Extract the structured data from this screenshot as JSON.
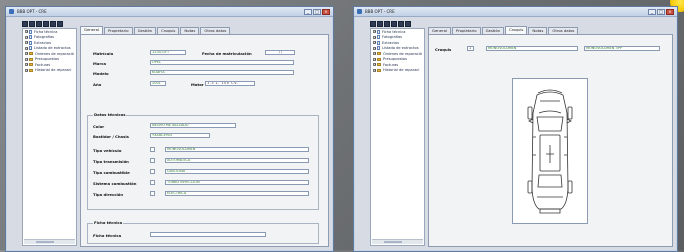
{
  "left_window": {
    "title": "BBB OPT - CRE",
    "tree": [
      {
        "label": "Ficha técnica",
        "type": "doc",
        "expand": "+"
      },
      {
        "label": "Fotografías",
        "type": "doc",
        "expand": "+"
      },
      {
        "label": "Extractos",
        "type": "doc",
        "expand": "+"
      },
      {
        "label": "Listado de extractos",
        "type": "doc",
        "expand": "+"
      },
      {
        "label": "Órdenes de reparació",
        "type": "folder",
        "expand": "+"
      },
      {
        "label": "Presupuestos",
        "type": "folder",
        "expand": "+"
      },
      {
        "label": "Facturas",
        "type": "folder",
        "expand": "+"
      },
      {
        "label": "Historial de reparaci",
        "type": "folder",
        "expand": "+"
      }
    ],
    "tabs": [
      "General",
      "Propietario",
      "Gestión",
      "Croquis",
      "Notas",
      "Otros datos"
    ],
    "active_tab": "General",
    "form": {
      "matricula_label": "Matrícula",
      "matricula_value": "1234-GFT",
      "fecha_label": "Fecha de matriculación",
      "fecha_value": "/ /",
      "marca_label": "Marca",
      "marca_value": "OPEL",
      "modelo_label": "Modelo",
      "modelo_value": "KOAFIA",
      "ano_label": "Año",
      "ano_value": "2001",
      "motor_label": "Motor",
      "motor_value": "1.3 L. 100 CV.",
      "datos_tecnicos_title": "Datos técnicos",
      "color_label": "Color",
      "color_value": "NEGRO METALIZADO",
      "bastidor_label": "Bastidor / Chasis",
      "bastidor_value": "YXZ8L3903",
      "vehiculo_label": "Tipo vehículo",
      "vehiculo_value": "MONOVOLUMEN",
      "transmision_label": "Tipo transmisión",
      "transmision_value": "AUTOMÁTICA",
      "combustible_label": "Tipo combustible",
      "combustible_value": "GASOLINA",
      "sistema_label": "Sistema combustión",
      "sistema_value": "TURBO INYECCIÓN",
      "direccion_label": "Tipo dirección",
      "direccion_value": "ELÉCTRICA",
      "ficha_group_title": "Ficha técnica",
      "ficha_label": "Ficha técnica",
      "ficha_value": ""
    }
  },
  "right_window": {
    "title": "BBB OPT - CRE",
    "tree": [
      {
        "label": "Ficha técnica",
        "type": "doc",
        "expand": "+"
      },
      {
        "label": "Fotografías",
        "type": "doc",
        "expand": "+"
      },
      {
        "label": "Extractos",
        "type": "doc",
        "expand": "+"
      },
      {
        "label": "Listado de extractos",
        "type": "doc",
        "expand": "+"
      },
      {
        "label": "Órdenes de reparació",
        "type": "folder",
        "expand": "+"
      },
      {
        "label": "Presupuestos",
        "type": "folder",
        "expand": "+"
      },
      {
        "label": "Facturas",
        "type": "folder",
        "expand": "+"
      },
      {
        "label": "Historial de reparaci",
        "type": "folder",
        "expand": "+"
      }
    ],
    "tabs": [
      "General",
      "Propietario",
      "Gestión",
      "Croquis",
      "Notas",
      "Otros datos"
    ],
    "active_tab": "Croquis",
    "croquis": {
      "label": "Croquis",
      "code_value": "1",
      "value_1": "MONOVOLUMEN",
      "value_2": "MONOVOLUMEN 3PP"
    }
  },
  "colors": {
    "background": "#6f7275",
    "window_face": "#d7dbe4",
    "field_text": "#2e7a2e",
    "accent_yellow": "#f4c400"
  }
}
